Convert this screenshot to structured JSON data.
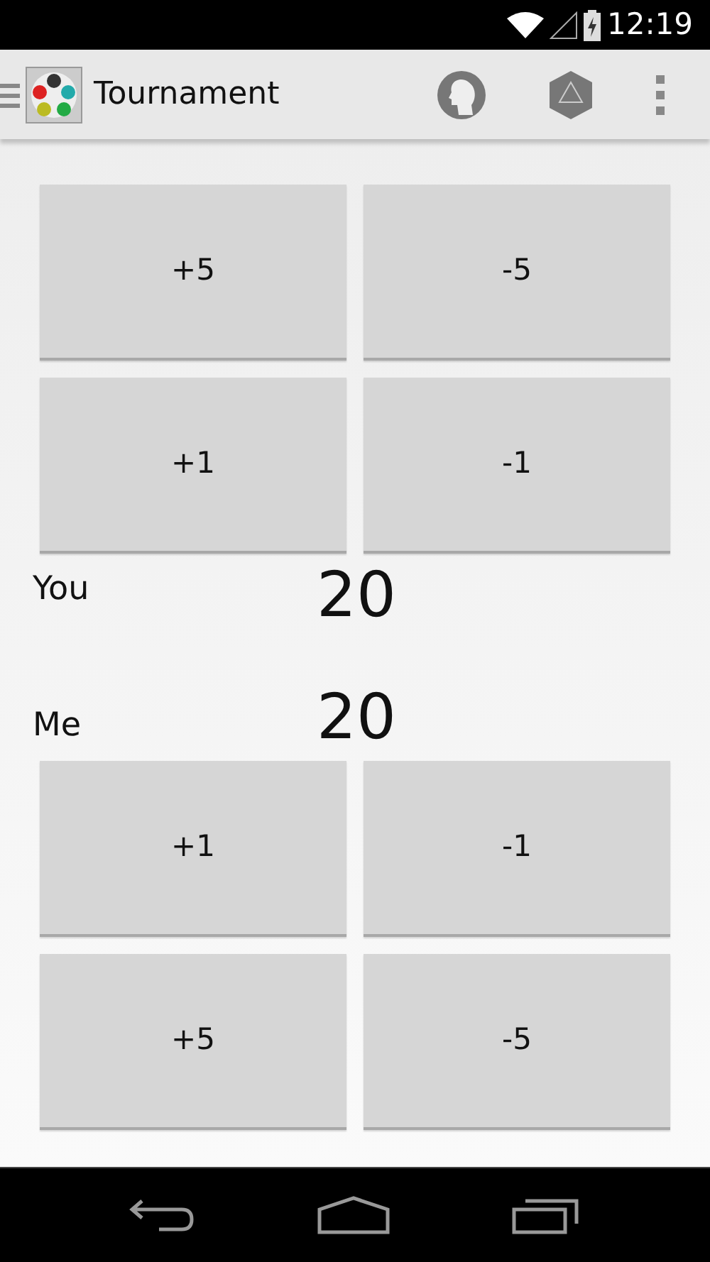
{
  "status_bar": {
    "time": "12:19"
  },
  "action_bar": {
    "title": "Tournament"
  },
  "top_buttons": [
    {
      "label": "+5"
    },
    {
      "label": "-5"
    },
    {
      "label": "+1"
    },
    {
      "label": "-1"
    }
  ],
  "players": [
    {
      "name": "You",
      "life": "20"
    },
    {
      "name": "Me",
      "life": "20"
    }
  ],
  "bottom_buttons": [
    {
      "label": "+1"
    },
    {
      "label": "-1"
    },
    {
      "label": "+5"
    },
    {
      "label": "-5"
    }
  ]
}
